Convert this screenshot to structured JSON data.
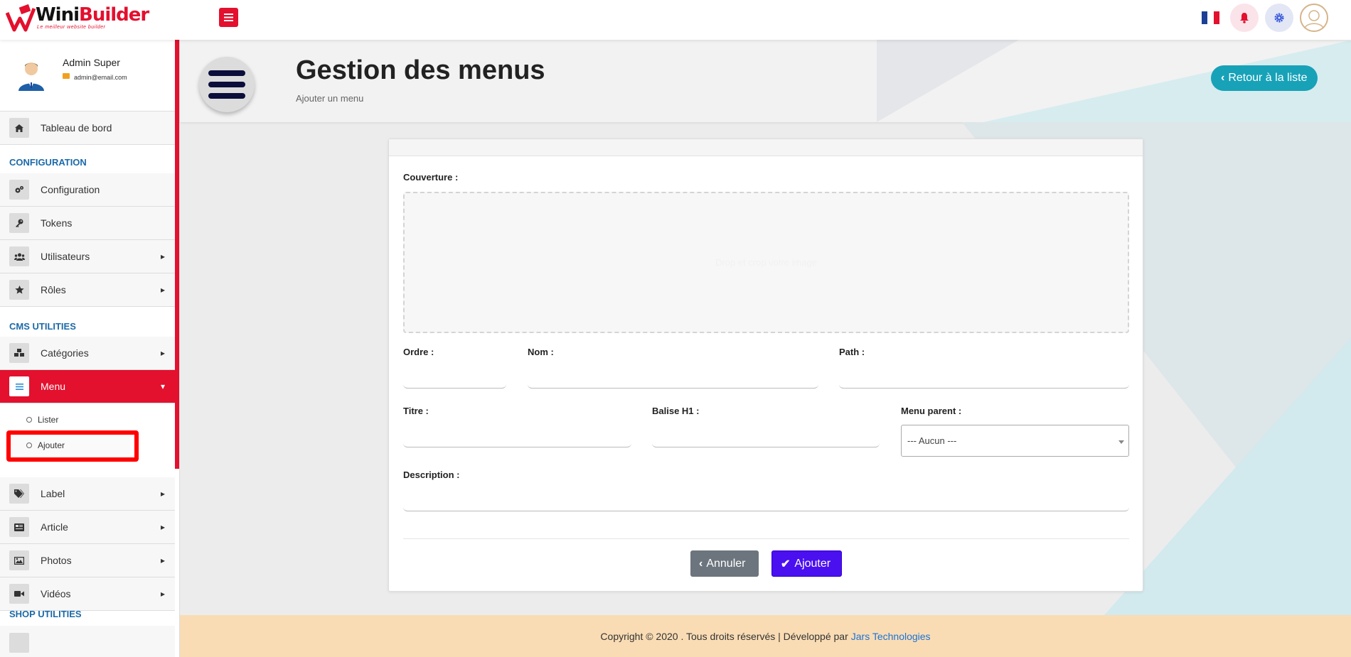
{
  "topbar": {
    "logo": {
      "brand_a": "Wini",
      "brand_b": "Builder",
      "tagline": "Le meilleur website builder"
    },
    "icons": [
      "menu-icon",
      "flag-icon",
      "bell-icon",
      "gear-icon",
      "user-icon"
    ],
    "colors": {
      "accent": "#e3102e",
      "bell_bg": "#fbe3ea",
      "gear_bg": "#e3e6f5"
    }
  },
  "sidebar": {
    "profile": {
      "name": "Admin Super",
      "email": "admin@email.com"
    },
    "dashboard": "Tableau de bord",
    "sections": {
      "configuration": "CONFIGURATION",
      "cms": "CMS UTILITIES",
      "shop": "SHOP UTILITIES"
    },
    "items": {
      "configuration": "Configuration",
      "tokens": "Tokens",
      "users": "Utilisateurs",
      "roles": "Rôles",
      "categories": "Catégories",
      "menu": "Menu",
      "label": "Label",
      "article": "Article",
      "photos": "Photos",
      "videos": "Vidéos"
    },
    "menu_sub": {
      "list": "Lister",
      "add": "Ajouter"
    }
  },
  "header": {
    "title": "Gestion des menus",
    "subtitle": "Ajouter un menu",
    "back_button": "Retour à la liste"
  },
  "form": {
    "cover_label": "Couverture :",
    "dropzone_text": "Drop et crop votre image",
    "order_label": "Ordre :",
    "name_label": "Nom :",
    "path_label": "Path :",
    "title_label": "Titre :",
    "h1_label": "Balise H1 :",
    "parent_label": "Menu parent :",
    "parent_selected": "--- Aucun ---",
    "description_label": "Description :",
    "cancel_button": "Annuler",
    "add_button": "Ajouter"
  },
  "footer": {
    "text": "Copyright © 2020 . Tous droits réservés | Développé par",
    "link": "Jars Technologies"
  }
}
